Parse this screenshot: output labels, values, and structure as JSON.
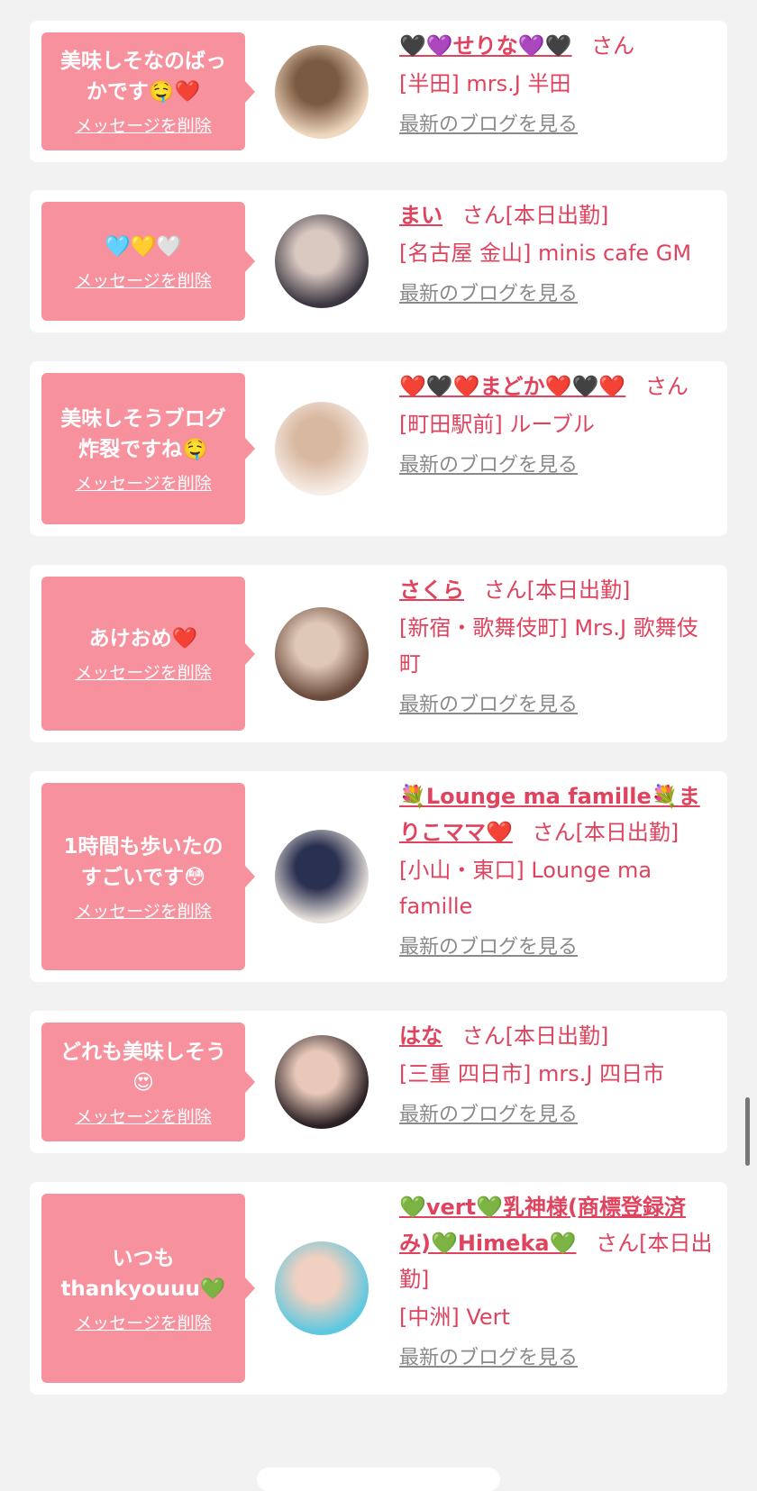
{
  "suffix_san": "さん",
  "cards": [
    {
      "message": "美味しそなのばっ\nかです🤤❤️",
      "delete_label": "メッセージを削除",
      "name": "🖤💜せりな💜🖤",
      "status": "",
      "shop": "[半田] mrs.J 半田",
      "blog_link": "最新のブログを見る",
      "avatar_colors": [
        "#f0d8c0",
        "#7a5a40"
      ]
    },
    {
      "message": "🩵💛🤍",
      "delete_label": "メッセージを削除",
      "name": "まい",
      "status": "[本日出勤]",
      "shop": "[名古屋 金山] minis cafe GM",
      "blog_link": "最新のブログを見る",
      "avatar_colors": [
        "#3a3540",
        "#d8c8c0"
      ]
    },
    {
      "message": "美味しそうブログ\n炸裂ですね🤤",
      "delete_label": "メッセージを削除",
      "name": "❤️🖤❤️まどか❤️🖤❤️",
      "status": "",
      "shop": "[町田駅前] ルーブル",
      "blog_link": "最新のブログを見る",
      "avatar_colors": [
        "#f6ede6",
        "#d9b8a0"
      ]
    },
    {
      "message": "あけおめ❤️",
      "delete_label": "メッセージを削除",
      "name": "さくら",
      "status": "[本日出勤]",
      "shop": "[新宿・歌舞伎町] Mrs.J 歌舞伎町",
      "blog_link": "最新のブログを見る",
      "avatar_colors": [
        "#6a4a3a",
        "#e0c8b8"
      ]
    },
    {
      "message": "1時間も歩いたの\nすごいです😳",
      "delete_label": "メッセージを削除",
      "name": "💐Lounge ma famille💐まりこママ❤️",
      "status": "[本日出勤]",
      "shop": "[小山・東口] Lounge ma famille",
      "blog_link": "最新のブログを見る",
      "avatar_colors": [
        "#e8e2dc",
        "#2a3050"
      ]
    },
    {
      "message": "どれも美味しそう\n😍",
      "delete_label": "メッセージを削除",
      "name": "はな",
      "status": "[本日出勤]",
      "shop": "[三重 四日市] mrs.J 四日市",
      "blog_link": "最新のブログを見る",
      "avatar_colors": [
        "#2a2024",
        "#e8c8b8"
      ]
    },
    {
      "message": "いつも\nthankyouuu💚",
      "delete_label": "メッセージを削除",
      "name": "💚vert💚乳神様(商標登録済み)💚Himeka💚",
      "status": "[本日出勤]",
      "shop": "[中洲] Vert",
      "blog_link": "最新のブログを見る",
      "avatar_colors": [
        "#5ec8e0",
        "#f0d0c0"
      ]
    }
  ]
}
